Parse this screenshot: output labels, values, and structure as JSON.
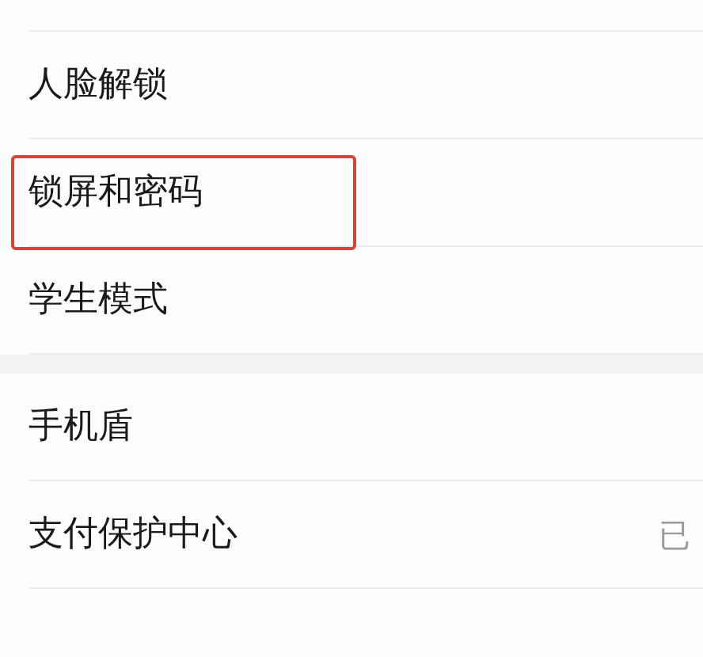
{
  "groups": [
    {
      "items": [
        {
          "label": "人脸解锁",
          "highlighted": false
        },
        {
          "label": "锁屏和密码",
          "highlighted": true
        },
        {
          "label": "学生模式",
          "highlighted": false
        }
      ]
    },
    {
      "items": [
        {
          "label": "手机盾",
          "highlighted": false
        },
        {
          "label": "支付保护中心",
          "highlighted": false,
          "value": "已"
        }
      ]
    }
  ]
}
